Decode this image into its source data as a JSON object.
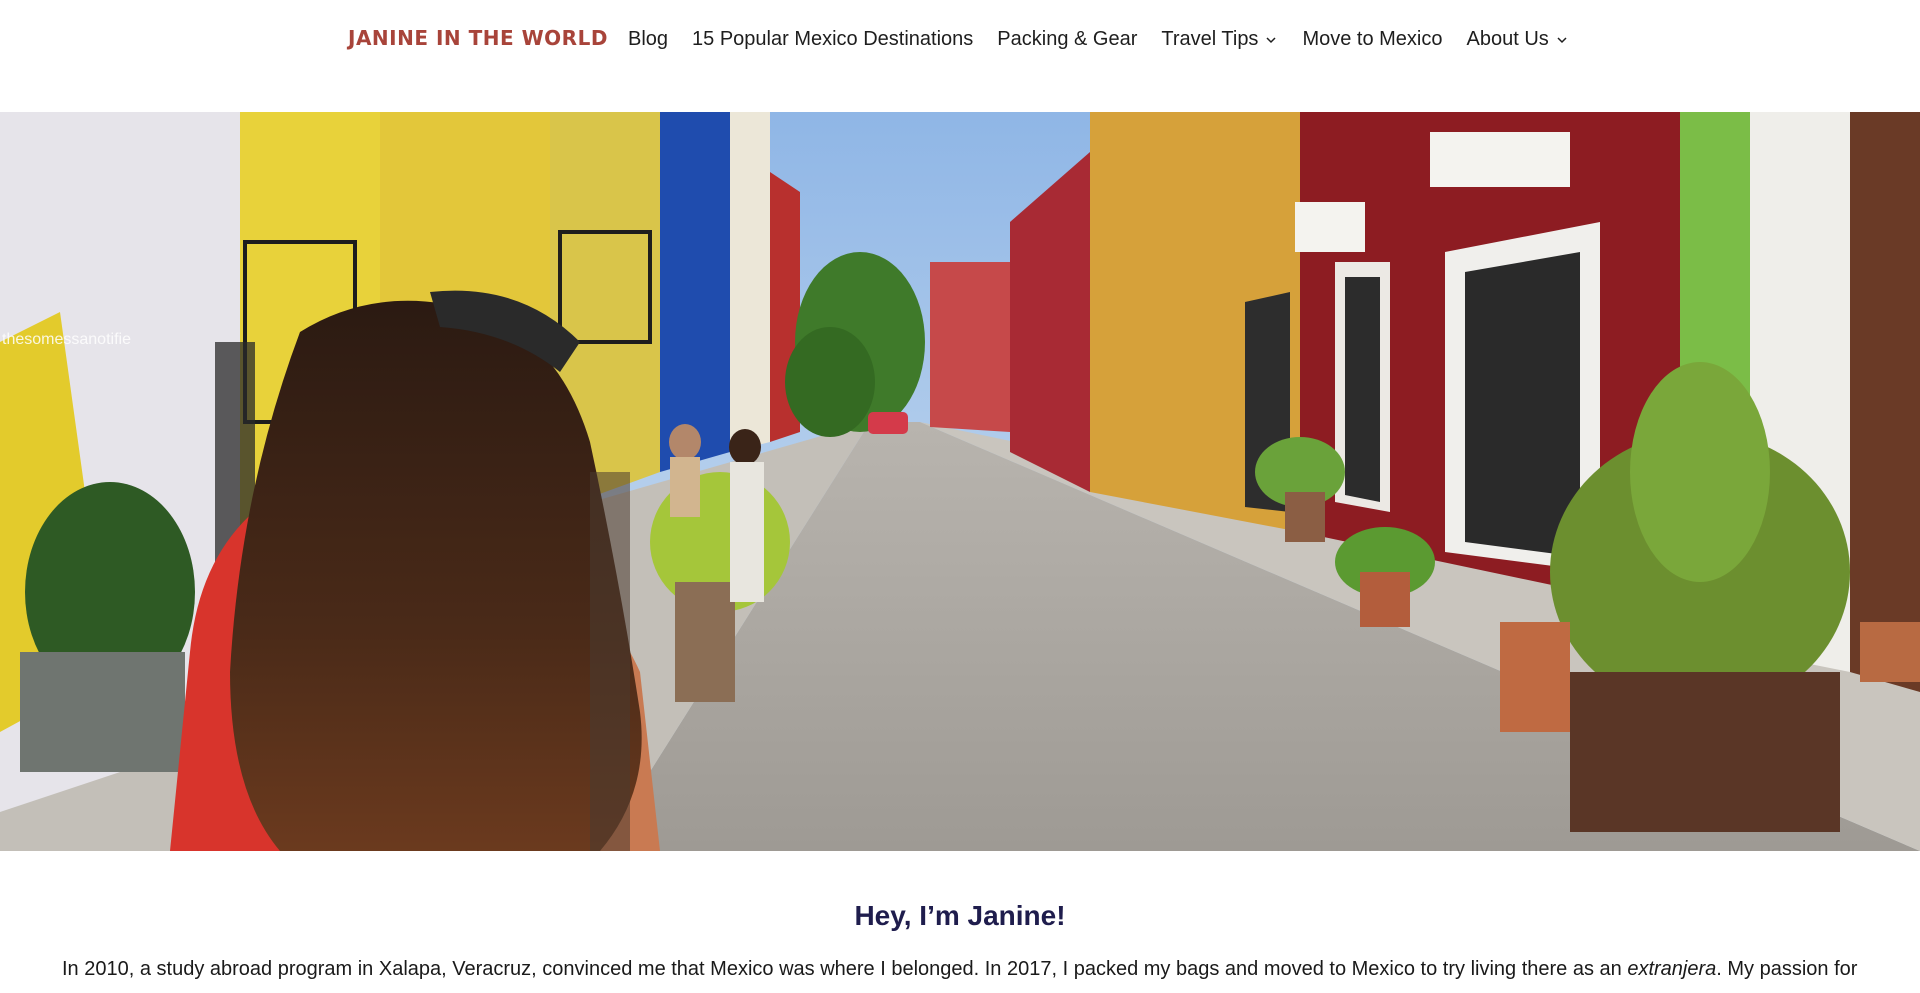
{
  "header": {
    "logo": "JANINE IN THE WORLD",
    "nav": [
      {
        "label": "Blog",
        "has_dropdown": false
      },
      {
        "label": "15 Popular Mexico Destinations",
        "has_dropdown": false
      },
      {
        "label": "Packing & Gear",
        "has_dropdown": false
      },
      {
        "label": "Travel Tips",
        "has_dropdown": true
      },
      {
        "label": "Move to Mexico",
        "has_dropdown": false
      },
      {
        "label": "About Us",
        "has_dropdown": true
      }
    ]
  },
  "hero": {
    "wall_text": "thesomessanotifie"
  },
  "intro": {
    "heading": "Hey, I’m Janine!",
    "text_before": "In 2010, a study abroad program in Xalapa, Veracruz, convinced me that Mexico was where I belonged. In 2017, I packed my bags and moved to Mexico to try living there as an ",
    "text_italic": "extranjera",
    "text_after": ". My passion for"
  },
  "colors": {
    "logo": "#a8443a",
    "heading": "#1f1d4d",
    "nav_text": "#1e1e1e"
  }
}
